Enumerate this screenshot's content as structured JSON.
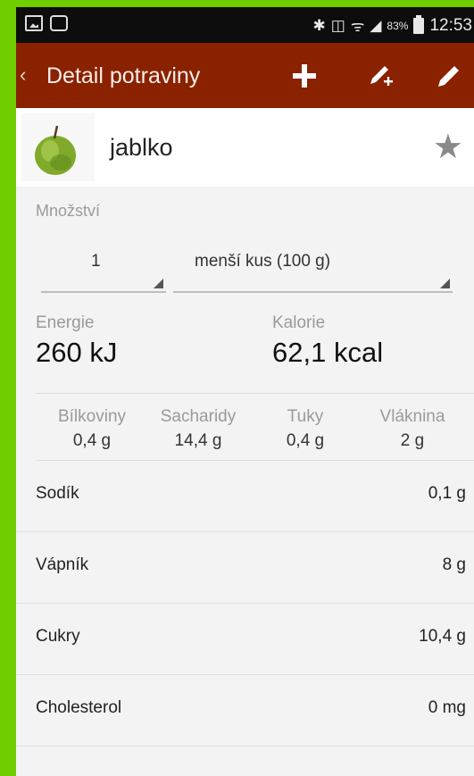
{
  "status_bar": {
    "battery_percent": "83%",
    "time": "12:53"
  },
  "action_bar": {
    "back_icon": "chevron-left-icon",
    "title": "Detail potraviny",
    "actions": [
      "plus-icon",
      "pencil-plus-icon",
      "pencil-icon"
    ]
  },
  "food": {
    "name": "jablko",
    "image": "apple-image",
    "favorite_icon": "star-icon"
  },
  "quantity": {
    "label": "Množství",
    "amount": "1",
    "unit": "menší kus (100 g)"
  },
  "energy": {
    "label": "Energie",
    "value": "260 kJ"
  },
  "calories": {
    "label": "Kalorie",
    "value": "62,1 kcal"
  },
  "macros": [
    {
      "label": "Bílkoviny",
      "value": "0,4 g"
    },
    {
      "label": "Sacharidy",
      "value": "14,4 g"
    },
    {
      "label": "Tuky",
      "value": "0,4 g"
    },
    {
      "label": "Vláknina",
      "value": "2 g"
    }
  ],
  "details": [
    {
      "name": "Sodík",
      "value": "0,1 g"
    },
    {
      "name": "Vápník",
      "value": "8 g"
    },
    {
      "name": "Cukry",
      "value": "10,4 g"
    },
    {
      "name": "Cholesterol",
      "value": "0 mg"
    }
  ],
  "colors": {
    "action_bar": "#8a2200",
    "background_frame": "#6fcd00",
    "content_bg": "#f3f3f3"
  }
}
